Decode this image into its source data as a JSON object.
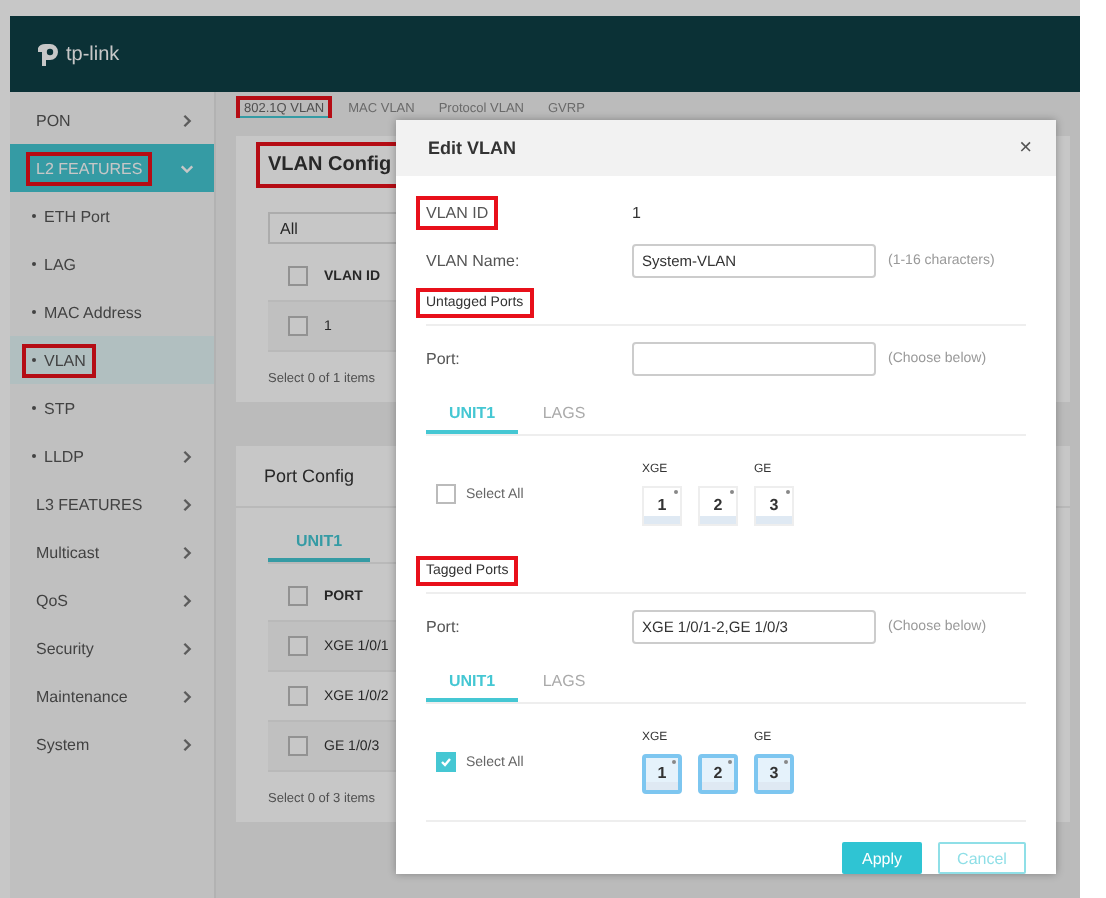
{
  "header": {
    "logo": "tp-link"
  },
  "sidebar": {
    "items": [
      {
        "label": "PON",
        "selected": false,
        "expanded": false,
        "highlighted": false
      },
      {
        "label": "L2 FEATURES",
        "selected": true,
        "expanded": true,
        "highlighted": true,
        "children": [
          {
            "label": "ETH Port",
            "selected": false,
            "highlighted": false,
            "has_submenu": false
          },
          {
            "label": "LAG",
            "selected": false,
            "highlighted": false,
            "has_submenu": false
          },
          {
            "label": "MAC Address",
            "selected": false,
            "highlighted": false,
            "has_submenu": false
          },
          {
            "label": "VLAN",
            "selected": true,
            "highlighted": true,
            "has_submenu": false
          },
          {
            "label": "STP",
            "selected": false,
            "highlighted": false,
            "has_submenu": false
          },
          {
            "label": "LLDP",
            "selected": false,
            "highlighted": false,
            "has_submenu": true
          }
        ]
      },
      {
        "label": "L3 FEATURES",
        "selected": false,
        "expanded": false,
        "highlighted": false
      },
      {
        "label": "Multicast",
        "selected": false,
        "expanded": false,
        "highlighted": false
      },
      {
        "label": "QoS",
        "selected": false,
        "expanded": false,
        "highlighted": false
      },
      {
        "label": "Security",
        "selected": false,
        "expanded": false,
        "highlighted": false
      },
      {
        "label": "Maintenance",
        "selected": false,
        "expanded": false,
        "highlighted": false
      },
      {
        "label": "System",
        "selected": false,
        "expanded": false,
        "highlighted": false
      }
    ]
  },
  "tabs": [
    {
      "label": "802.1Q VLAN",
      "selected": true,
      "highlighted": true
    },
    {
      "label": "MAC VLAN",
      "selected": false,
      "highlighted": false
    },
    {
      "label": "Protocol VLAN",
      "selected": false,
      "highlighted": false
    },
    {
      "label": "GVRP",
      "selected": false,
      "highlighted": false
    }
  ],
  "vlan_config": {
    "title": "VLAN Config",
    "highlighted": true,
    "filter": "All",
    "header_checked": false,
    "columns": [
      "VLAN ID"
    ],
    "rows": [
      {
        "checked": false,
        "cells": [
          "1"
        ]
      }
    ],
    "footer": "Select 0 of 1 items"
  },
  "port_config": {
    "title": "Port Config",
    "tabs": [
      {
        "label": "UNIT1",
        "selected": true
      }
    ],
    "header_checked": false,
    "columns": [
      "PORT"
    ],
    "rows": [
      {
        "checked": false,
        "cells": [
          "XGE 1/0/1"
        ]
      },
      {
        "checked": false,
        "cells": [
          "XGE 1/0/2"
        ]
      },
      {
        "checked": false,
        "cells": [
          "GE 1/0/3"
        ]
      }
    ],
    "footer": "Select 0 of 3 items"
  },
  "dialog": {
    "title": "Edit VLAN",
    "close": "×",
    "vlan_id": {
      "label": "VLAN ID",
      "value": "1",
      "highlighted": true
    },
    "vlan_name": {
      "label": "VLAN Name:",
      "value": "System-VLAN",
      "hint": "(1-16 characters)"
    },
    "sections": [
      {
        "title": "Untagged Ports",
        "highlighted": true,
        "port_label": "Port:",
        "hint": "(Choose below)",
        "tabs": [
          {
            "label": "UNIT1",
            "selected": true
          },
          {
            "label": "LAGS",
            "selected": false
          }
        ],
        "select_all": {
          "label": "Select All",
          "checked": false
        },
        "groups": [
          {
            "label": "XGE",
            "ports": [
              {
                "label": "1",
                "selected": false
              },
              {
                "label": "2",
                "selected": false
              }
            ]
          },
          {
            "label": "GE",
            "ports": [
              {
                "label": "3",
                "selected": false
              }
            ]
          }
        ]
      },
      {
        "title": "Tagged Ports",
        "highlighted": true,
        "port_label": "Port:",
        "port_value": "XGE 1/0/1-2,GE 1/0/3",
        "hint": "(Choose below)",
        "tabs": [
          {
            "label": "UNIT1",
            "selected": true
          },
          {
            "label": "LAGS",
            "selected": false
          }
        ],
        "select_all": {
          "label": "Select All",
          "checked": true
        },
        "groups": [
          {
            "label": "XGE",
            "ports": [
              {
                "label": "1",
                "selected": true
              },
              {
                "label": "2",
                "selected": true
              }
            ]
          },
          {
            "label": "GE",
            "ports": [
              {
                "label": "3",
                "selected": true
              }
            ]
          }
        ]
      }
    ],
    "buttons": [
      {
        "label": "Apply",
        "kind": "primary"
      },
      {
        "label": "Cancel",
        "kind": "secondary"
      }
    ]
  }
}
